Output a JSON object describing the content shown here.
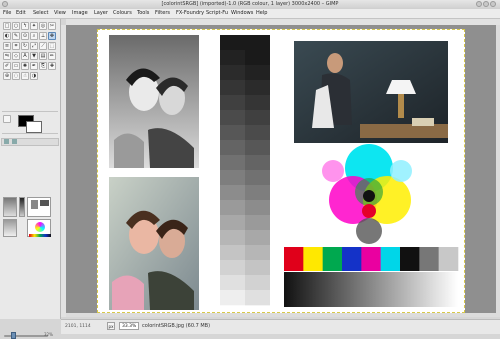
{
  "window": {
    "title": "[colorintSRGB] (imported)-1.0 (RGB colour, 1 layer) 3000x2400 – GIMP"
  },
  "menubar": {
    "items": [
      "File",
      "Edit",
      "Select",
      "View",
      "Image",
      "Layer",
      "Colours",
      "Tools",
      "Filters",
      "FX-Foundry",
      "Script-Fu",
      "Windows",
      "Help"
    ]
  },
  "toolbox": {
    "tools": [
      "rect-select",
      "ellipse-select",
      "free-select",
      "fuzzy-select",
      "select-by-color",
      "scissors",
      "foreground-select",
      "paths",
      "color-picker",
      "zoom",
      "measure",
      "move",
      "align",
      "crop",
      "rotate",
      "scale",
      "shear",
      "perspective",
      "flip",
      "cage",
      "text",
      "bucket-fill",
      "blend",
      "pencil",
      "paintbrush",
      "eraser",
      "airbrush",
      "ink",
      "clone",
      "heal",
      "perspective-clone",
      "blur",
      "smudge",
      "dodge-burn"
    ],
    "foreground_color": "#000000",
    "background_color": "#ffffff"
  },
  "status": {
    "coords": "2101, 1114",
    "unit": "px",
    "zoom": "33.3%",
    "info": "colorintSRGB.jpg (60.7 MB)"
  },
  "brush_size": "32%",
  "chart_strip": {
    "gray_steps": [
      "#1a1a1a",
      "#222",
      "#2b2b2b",
      "#353535",
      "#404040",
      "#4b4b4b",
      "#575757",
      "#646464",
      "#717171",
      "#7e7e7e",
      "#8c8c8c",
      "#9a9a9a",
      "#a8a8a8",
      "#b6b6b6",
      "#c4c4c4",
      "#d2d2d2",
      "#e0e0e0",
      "#eeeeee"
    ],
    "color_bars": [
      "#e0001a",
      "#ffe800",
      "#00a84f",
      "#1432c8",
      "#ea00a0",
      "#00d6e8",
      "#111111",
      "#777777",
      "#c8c8c8"
    ]
  },
  "accent": "#5b87b7"
}
